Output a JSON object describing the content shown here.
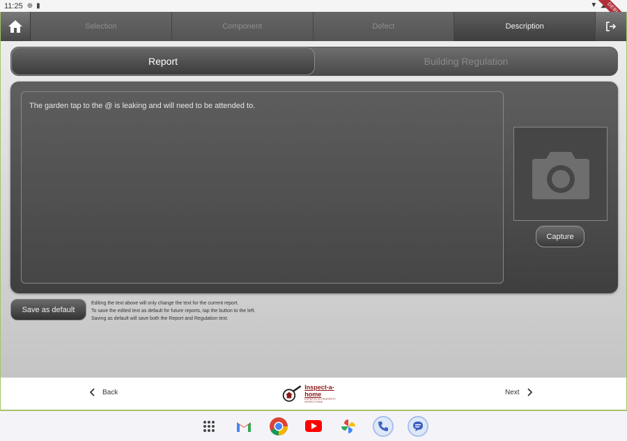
{
  "status_bar": {
    "time": "11:25",
    "debug_label": "DEBUG"
  },
  "tabs": [
    {
      "label": "Selection",
      "active": false
    },
    {
      "label": "Component",
      "active": false
    },
    {
      "label": "Defect",
      "active": false
    },
    {
      "label": "Description",
      "active": true
    }
  ],
  "segments": {
    "report_label": "Report",
    "regulation_label": "Building Regulation",
    "selected": "Report"
  },
  "report": {
    "text": "The garden tap to the @ is leaking and will need to be attended to."
  },
  "photo": {
    "icon": "camera-icon",
    "capture_label": "Capture"
  },
  "save_default": {
    "label": "Save as default",
    "help_lines": [
      "Editing the text above will only change the text for the current report.",
      "To save the edited text as default for future reports, tap the button to the left.",
      "Saving as default will save both the Report and Regulation text."
    ]
  },
  "footer": {
    "back_label": "Back",
    "next_label": "Next",
    "logo_name": "Inspect-a-home",
    "logo_tagline": "EXPERTS IN PROPERTY INSPECTIONS"
  },
  "dock": {
    "apps": [
      "app-drawer-icon",
      "gmail-icon",
      "chrome-icon",
      "youtube-icon",
      "photos-icon",
      "phone-icon",
      "messages-icon"
    ]
  },
  "colors": {
    "accent_border": "#a6c26a",
    "logo_red": "#8b1a1a"
  }
}
